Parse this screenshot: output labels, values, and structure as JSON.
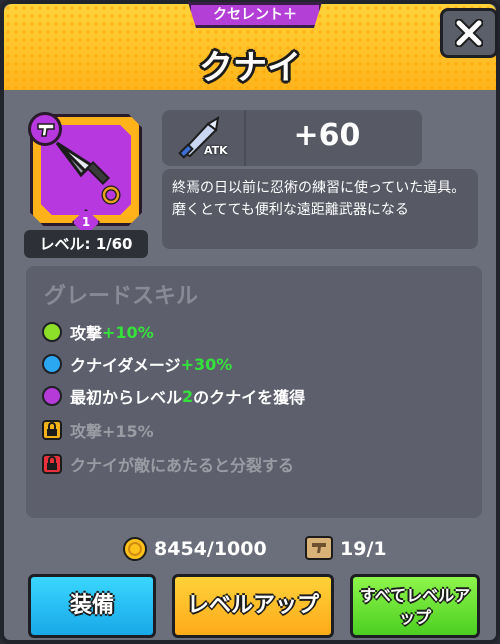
{
  "header": {
    "rarity": "クセレント＋",
    "title": "クナイ",
    "close_icon": "close-icon"
  },
  "item": {
    "level_label": "レベル: 1/60",
    "star_count": "1",
    "icon": "kunai-icon",
    "type_icon": "pistol-icon",
    "frame_color": "#ffb21a",
    "bg_color": "#b838e0"
  },
  "stats": {
    "atk_label": "ATK",
    "atk_value": "+60",
    "description": "終焉の日以前に忍術の練習に使っていた道具。磨くとてても便利な遠距離武器になる"
  },
  "skills": {
    "title": "グレードスキル",
    "rows": [
      {
        "icon": "green-dot",
        "color": "#8de02a",
        "text": "攻撃",
        "bonus": "+10%",
        "locked": false
      },
      {
        "icon": "blue-dot",
        "color": "#2aa7f0",
        "text": "クナイダメージ",
        "bonus": "+30%",
        "locked": false
      },
      {
        "icon": "purple-dot",
        "color": "#b53ad8",
        "text_a": "最初からレベル",
        "bonus": "2",
        "text_b": "のクナイを獲得",
        "locked": false
      },
      {
        "icon": "lock-icon",
        "color": "#f2b21a",
        "text": "攻撃+15%",
        "locked": true
      },
      {
        "icon": "lock-icon",
        "color": "#e8313a",
        "text": "クナイが敵にあたると分裂する",
        "locked": true
      }
    ]
  },
  "currency": {
    "coins": "8454/1000",
    "scrolls": "19/1"
  },
  "buttons": {
    "equip": "装備",
    "level_up": "レベルアップ",
    "level_all_line1": "すべてレベルア",
    "level_all_line2": "ップ"
  }
}
